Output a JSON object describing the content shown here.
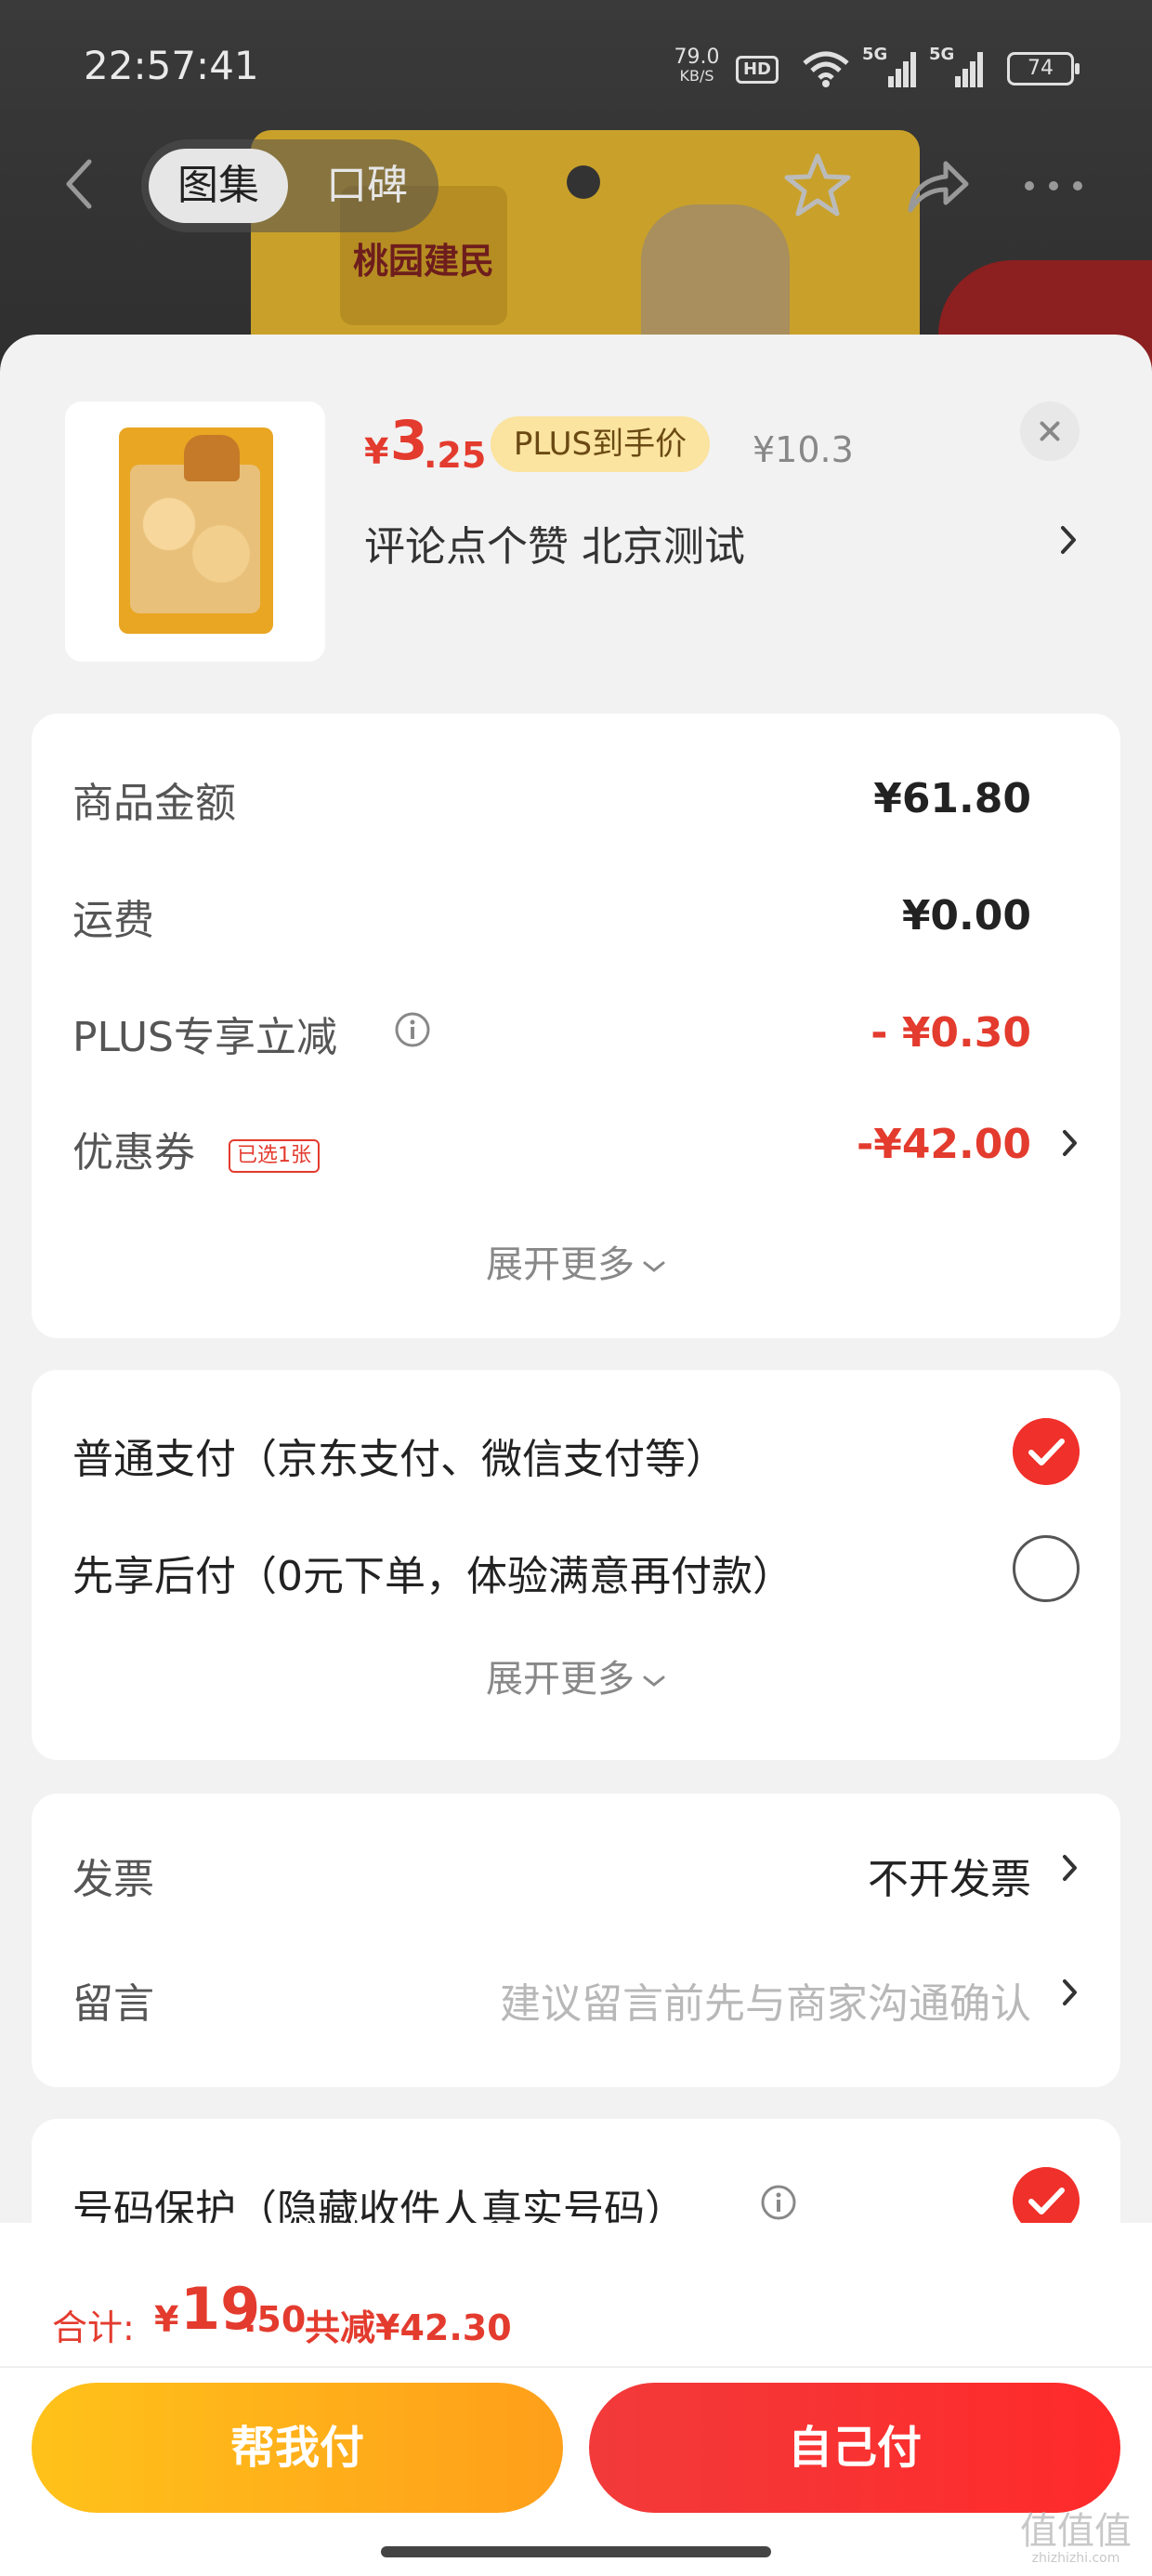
{
  "status_bar": {
    "time": "22:57:41",
    "net_speed_value": "79.0",
    "net_speed_unit": "KB/S",
    "hd": "HD",
    "signal_1": "5G",
    "signal_2": "5G",
    "battery": "74"
  },
  "header": {
    "tabs": [
      "图集",
      "口碑"
    ],
    "active_tab": "图集",
    "brand_name": "桃园建民"
  },
  "product": {
    "price_symbol": "¥",
    "price_int": "3",
    "price_dec": ".25",
    "plus_badge": "PLUS到手价",
    "original_price": "¥10.3",
    "spec": "评论点个赞  北京测试"
  },
  "amount_card": {
    "rows": [
      {
        "label": "商品金额",
        "value": "¥61.80"
      },
      {
        "label": "运费",
        "value": "¥0.00"
      },
      {
        "label": "PLUS专享立减",
        "value": "- ¥0.30"
      },
      {
        "label": "优惠券",
        "value": "-¥42.00",
        "tag": "已选1张"
      }
    ],
    "expand": "展开更多"
  },
  "payment_card": {
    "options": [
      {
        "label": "普通支付（京东支付、微信支付等）",
        "selected": true
      },
      {
        "label": "先享后付（0元下单，体验满意再付款）",
        "selected": false
      }
    ],
    "expand": "展开更多"
  },
  "invoice_card": {
    "invoice_label": "发票",
    "invoice_value": "不开发票",
    "message_label": "留言",
    "message_placeholder": "建议留言前先与商家沟通确认"
  },
  "protect_card": {
    "label": "号码保护（隐藏收件人真实号码）",
    "selected": true
  },
  "footer": {
    "total_label": "合计:",
    "total_symbol": "¥",
    "total_int": "19",
    "total_dec": ".50",
    "total_save": "共减¥42.30",
    "help_pay": "帮我付",
    "self_pay": "自己付"
  },
  "watermark": {
    "text": "值",
    "site": "zhizhizhi.com"
  },
  "colors": {
    "accent_red": "#e33b2e",
    "check_red": "#f0302a",
    "help_pay_gold": "#ffb21a",
    "self_pay_red": "#f53232"
  }
}
